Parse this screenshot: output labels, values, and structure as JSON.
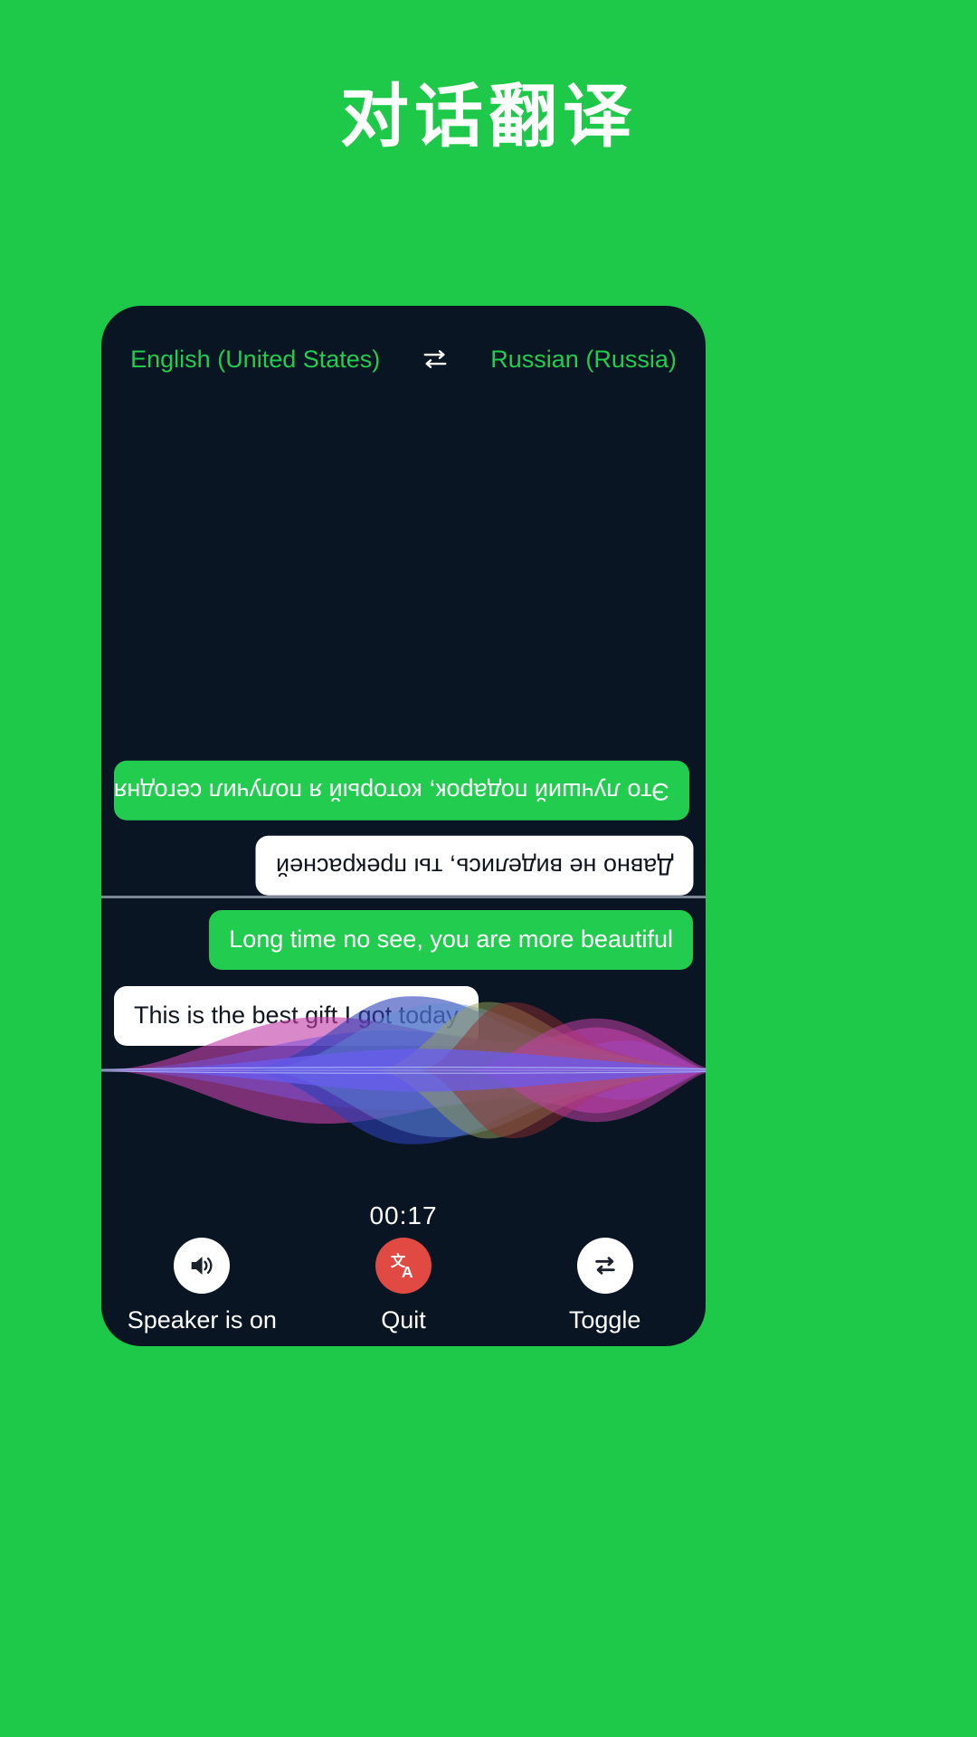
{
  "page": {
    "title": "对话翻译",
    "background_color": "#1ec94a",
    "card_background_color": "#0a1523",
    "accent_green": "#22cc4e",
    "quit_red": "#e04a43"
  },
  "language_bar": {
    "source_language": "English (United States)",
    "swap_icon": "swap-horizontal-icon",
    "target_language": "Russian (Russia)"
  },
  "foreign_pane": {
    "bubbles": [
      {
        "text": "Это лучший подарок, который я получил сегодня",
        "style": "green",
        "align": "left",
        "flipped": true
      },
      {
        "text": "Давно не виделись, ты прекрасней",
        "style": "white",
        "align": "right",
        "flipped": true
      }
    ]
  },
  "native_pane": {
    "bubbles": [
      {
        "text": "Long time no see, you are more beautiful",
        "style": "green",
        "align": "right",
        "flipped": false
      },
      {
        "text": "This is the best gift I got today",
        "style": "white",
        "align": "left",
        "flipped": false
      }
    ]
  },
  "waveform": {
    "name": "audio-waveform-visualizer",
    "colors": [
      "#2b3fb5",
      "#4f7fd0",
      "#9aa35a",
      "#8e2b2e",
      "#c13fa8",
      "#6e4fd8",
      "#5a5ce0"
    ]
  },
  "timer": {
    "value": "00:17"
  },
  "controls": [
    {
      "id": "speaker",
      "icon": "speaker-on-icon",
      "label": "Speaker is on",
      "circle": "white"
    },
    {
      "id": "quit",
      "icon": "translate-icon",
      "label": "Quit",
      "circle": "red"
    },
    {
      "id": "toggle",
      "icon": "repeat-swap-icon",
      "label": "Toggle",
      "circle": "white"
    }
  ]
}
